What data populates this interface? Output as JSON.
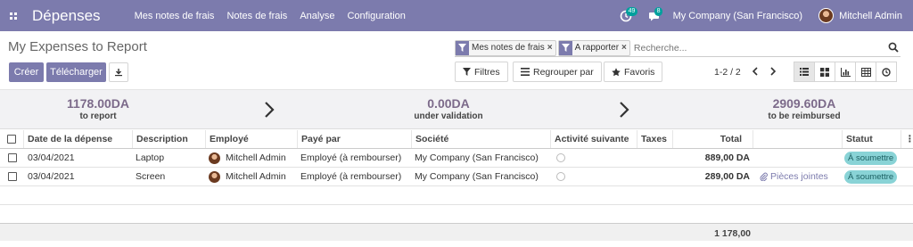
{
  "navbar": {
    "brand": "Dépenses",
    "menu": [
      "Mes notes de frais",
      "Notes de frais",
      "Analyse",
      "Configuration"
    ],
    "activity_count": "49",
    "messages_count": "8",
    "company": "My Company (San Francisco)",
    "user": "Mitchell Admin"
  },
  "control": {
    "title": "My Expenses to Report",
    "create_label": "Créer",
    "upload_label": "Télécharger",
    "facets": [
      "Mes notes de frais",
      "A rapporter"
    ],
    "search_placeholder": "Recherche...",
    "filters_label": "Filtres",
    "group_label": "Regrouper par",
    "favorites_label": "Favoris",
    "pager": "1-2 / 2"
  },
  "summary": {
    "report": {
      "amount": "1178.00DA",
      "label": "to report"
    },
    "validation": {
      "amount": "0.00DA",
      "label": "under validation"
    },
    "reimbursed": {
      "amount": "2909.60DA",
      "label": "to be reimbursed"
    }
  },
  "table": {
    "columns": [
      "Date de la dépense",
      "Description",
      "Employé",
      "Payé par",
      "Société",
      "Activité suivante",
      "Taxes",
      "Total",
      "Statut"
    ],
    "rows": [
      {
        "date": "03/04/2021",
        "description": "Laptop",
        "employee": "Mitchell Admin",
        "paid_by": "Employé (à rembourser)",
        "company": "My Company (San Francisco)",
        "total": "889,00 DA",
        "attachments": "",
        "status": "À soumettre"
      },
      {
        "date": "03/04/2021",
        "description": "Screen",
        "employee": "Mitchell Admin",
        "paid_by": "Employé (à rembourser)",
        "company": "My Company (San Francisco)",
        "total": "289,00 DA",
        "attachments": "Pièces jointes",
        "status": "À soumettre"
      }
    ],
    "grand_total": "1 178,00"
  },
  "colors": {
    "primary": "#7c7bad",
    "status_badge": "#89d3d6",
    "amount": "#7c6a8a"
  }
}
